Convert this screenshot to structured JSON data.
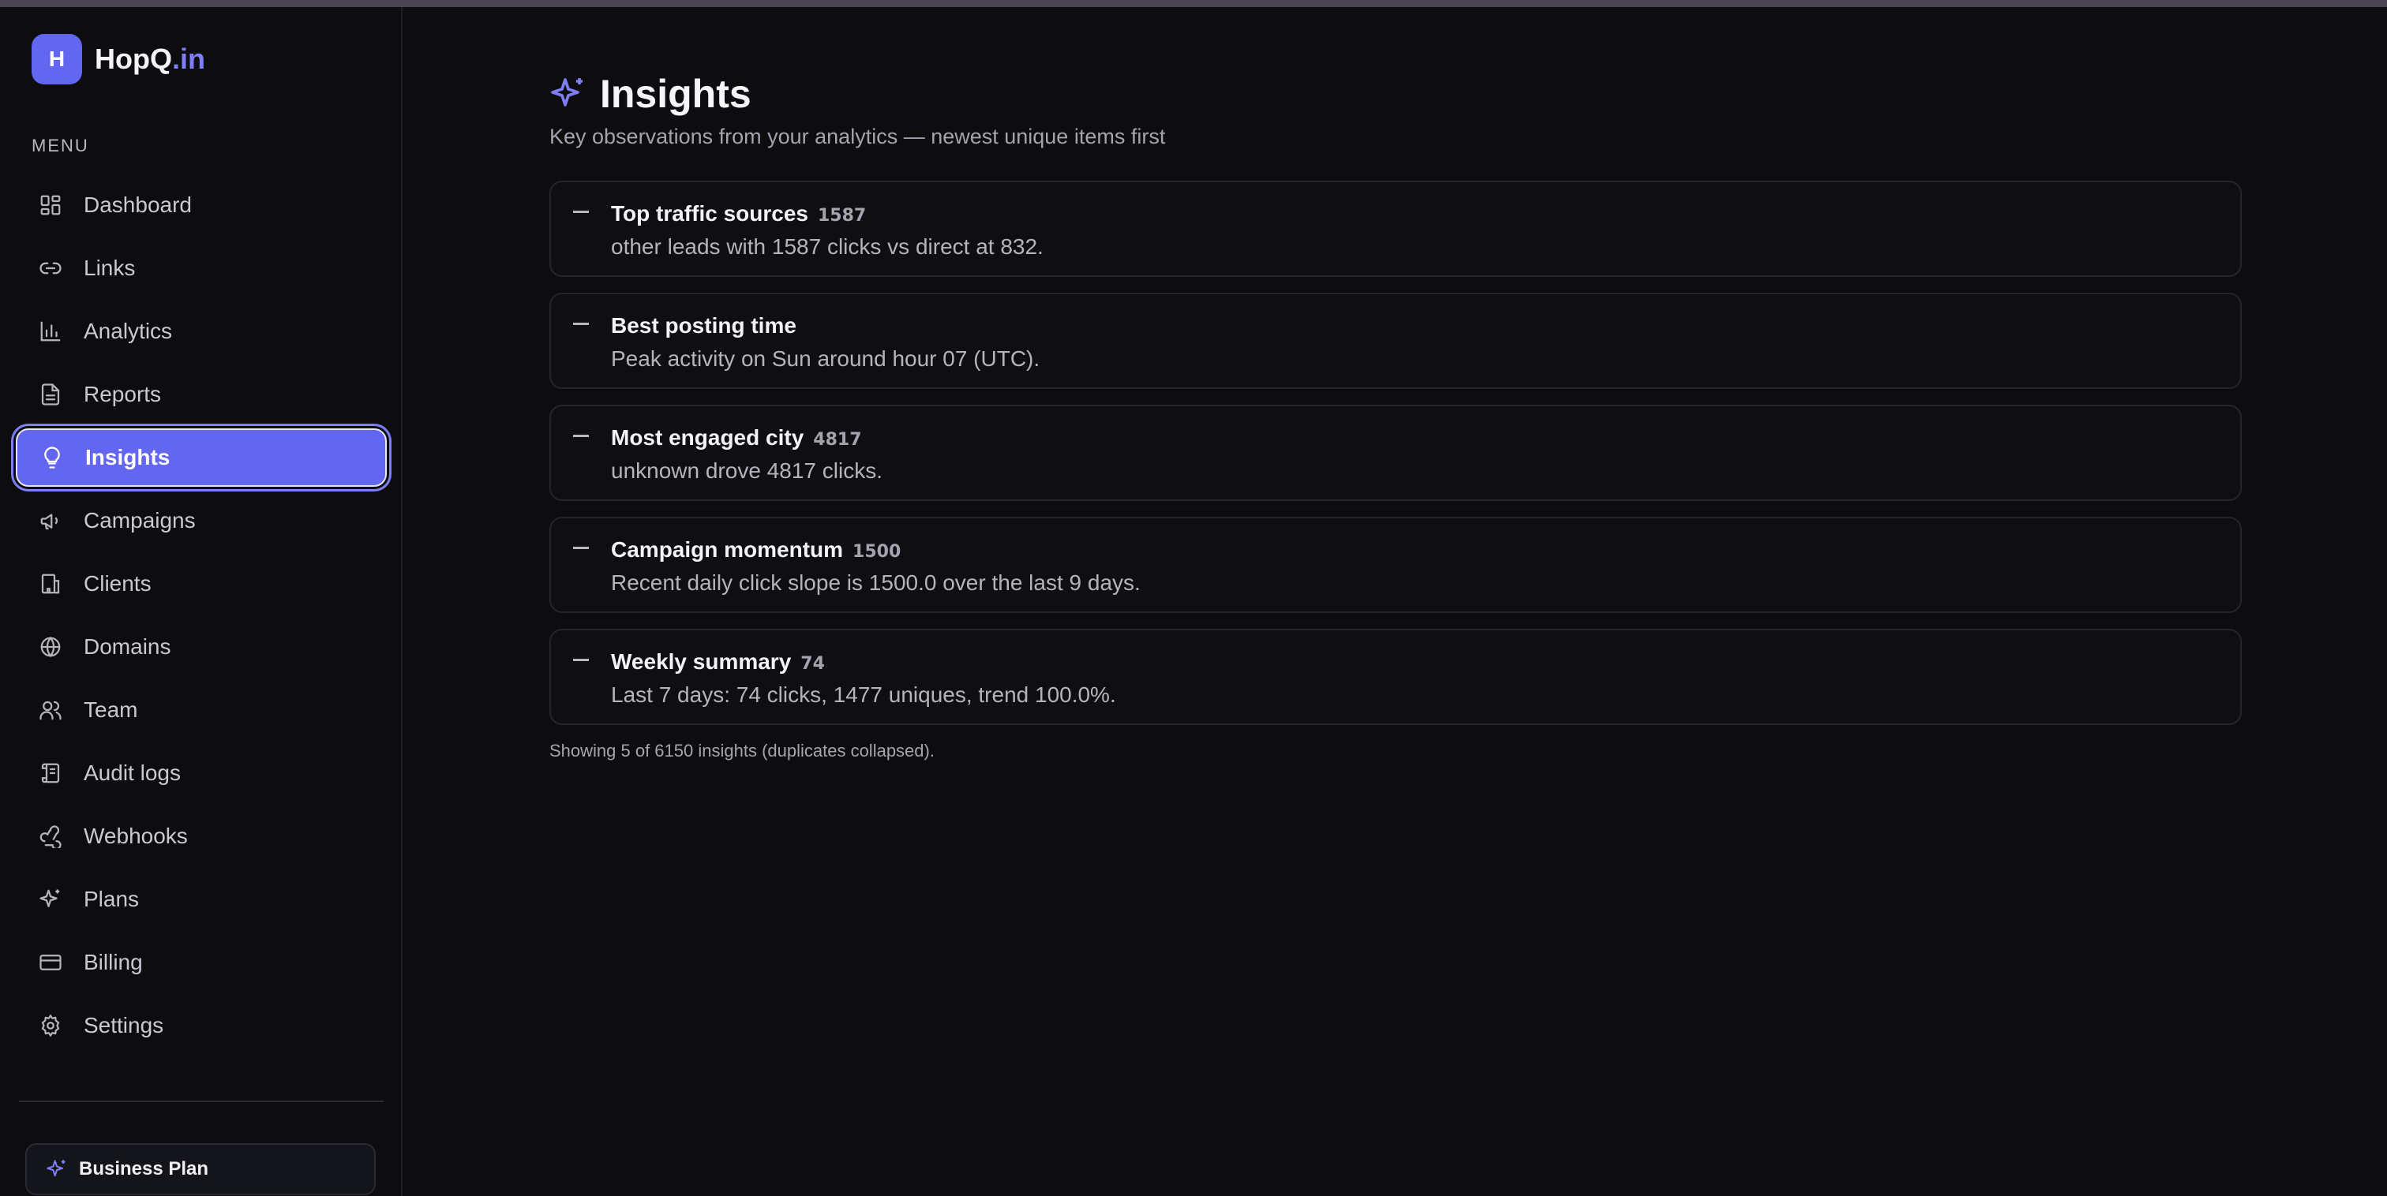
{
  "brand": {
    "badge": "H",
    "name": "HopQ",
    "tld": ".in"
  },
  "sidebar": {
    "menu_label": "MENU",
    "items": [
      {
        "label": "Dashboard",
        "icon": "dashboard-icon"
      },
      {
        "label": "Links",
        "icon": "link-icon"
      },
      {
        "label": "Analytics",
        "icon": "bar-chart-icon"
      },
      {
        "label": "Reports",
        "icon": "document-icon"
      },
      {
        "label": "Insights",
        "icon": "lightbulb-icon",
        "active": true
      },
      {
        "label": "Campaigns",
        "icon": "megaphone-icon"
      },
      {
        "label": "Clients",
        "icon": "building-icon"
      },
      {
        "label": "Domains",
        "icon": "globe-icon"
      },
      {
        "label": "Team",
        "icon": "users-icon"
      },
      {
        "label": "Audit logs",
        "icon": "scroll-icon"
      },
      {
        "label": "Webhooks",
        "icon": "webhook-icon"
      },
      {
        "label": "Plans",
        "icon": "sparkles-icon"
      },
      {
        "label": "Billing",
        "icon": "credit-card-icon"
      },
      {
        "label": "Settings",
        "icon": "gear-icon"
      }
    ],
    "plan_label": "Business Plan"
  },
  "main": {
    "title": "Insights",
    "subtitle": "Key observations from your analytics — newest unique items first",
    "cards": [
      {
        "title": "Top traffic sources",
        "count": "1587",
        "body": "other leads with 1587 clicks vs direct at 832."
      },
      {
        "title": "Best posting time",
        "count": "",
        "body": "Peak activity on Sun around hour 07 (UTC)."
      },
      {
        "title": "Most engaged city",
        "count": "4817",
        "body": "unknown drove 4817 clicks."
      },
      {
        "title": "Campaign momentum",
        "count": "1500",
        "body": "Recent daily click slope is 1500.0 over the last 9 days."
      },
      {
        "title": "Weekly summary",
        "count": "74",
        "body": "Last 7 days: 74 clicks, 1477 uniques, trend 100.0%."
      }
    ],
    "footer_note": "Showing 5 of 6150 insights (duplicates collapsed)."
  },
  "colors": {
    "accent": "#6366f1",
    "background": "#0d0d10"
  }
}
